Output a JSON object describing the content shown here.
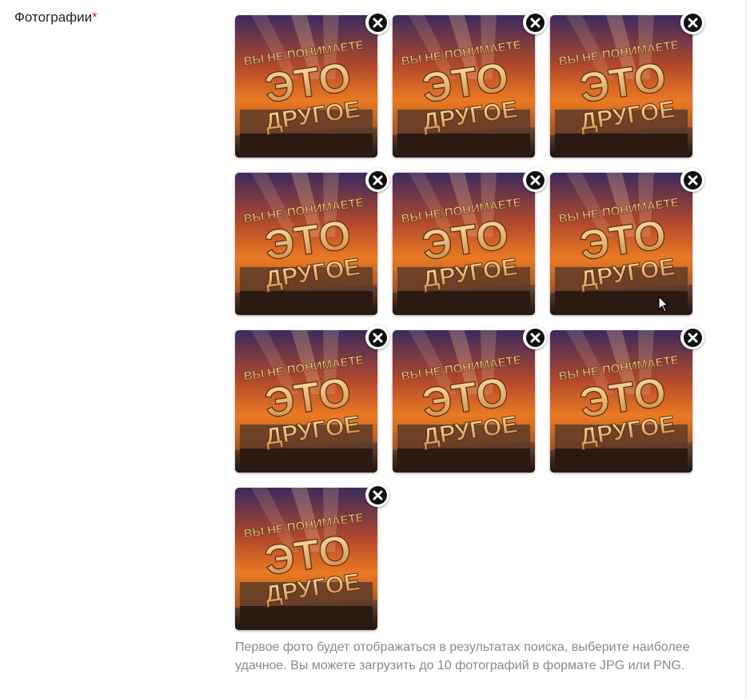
{
  "field": {
    "label": "Фотографии",
    "required_mark": "*"
  },
  "photos": [
    {
      "icon": "photo-thumbnail",
      "caption_top": "ВЫ НЕ ПОНИМАЕТЕ",
      "caption_main": "ЭТО",
      "caption_bottom": "ДРУГОЕ"
    },
    {
      "icon": "photo-thumbnail",
      "caption_top": "ВЫ НЕ ПОНИМАЕТЕ",
      "caption_main": "ЭТО",
      "caption_bottom": "ДРУГОЕ"
    },
    {
      "icon": "photo-thumbnail",
      "caption_top": "ВЫ НЕ ПОНИМАЕТЕ",
      "caption_main": "ЭТО",
      "caption_bottom": "ДРУГОЕ"
    },
    {
      "icon": "photo-thumbnail",
      "caption_top": "ВЫ НЕ ПОНИМАЕТЕ",
      "caption_main": "ЭТО",
      "caption_bottom": "ДРУГОЕ"
    },
    {
      "icon": "photo-thumbnail",
      "caption_top": "ВЫ НЕ ПОНИМАЕТЕ",
      "caption_main": "ЭТО",
      "caption_bottom": "ДРУГОЕ"
    },
    {
      "icon": "photo-thumbnail",
      "caption_top": "ВЫ НЕ ПОНИМАЕТЕ",
      "caption_main": "ЭТО",
      "caption_bottom": "ДРУГОЕ"
    },
    {
      "icon": "photo-thumbnail",
      "caption_top": "ВЫ НЕ ПОНИМАЕТЕ",
      "caption_main": "ЭТО",
      "caption_bottom": "ДРУГОЕ"
    },
    {
      "icon": "photo-thumbnail",
      "caption_top": "ВЫ НЕ ПОНИМАЕТЕ",
      "caption_main": "ЭТО",
      "caption_bottom": "ДРУГОЕ"
    },
    {
      "icon": "photo-thumbnail",
      "caption_top": "ВЫ НЕ ПОНИМАЕТЕ",
      "caption_main": "ЭТО",
      "caption_bottom": "ДРУГОЕ"
    },
    {
      "icon": "photo-thumbnail",
      "caption_top": "ВЫ НЕ ПОНИМАЕТЕ",
      "caption_main": "ЭТО",
      "caption_bottom": "ДРУГОЕ"
    }
  ],
  "remove_button_icon": "close-icon",
  "hint": "Первое фото будет отображаться в результатах поиска, выберите наиболее удачное. Вы можете загрузить до 10 фотографий в формате JPG или PNG.",
  "colors": {
    "required": "#e31b23",
    "hint_text": "#8a8a8a",
    "label_text": "#222222"
  }
}
